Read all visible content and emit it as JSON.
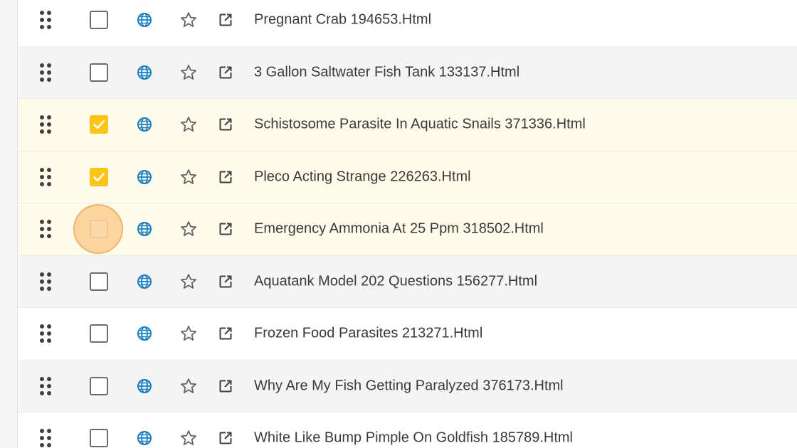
{
  "colors": {
    "checked": "#fcc419",
    "selected_row_bg": "#fffbea",
    "alt_row_bg": "#f4f4f4",
    "globe": "#1a7fc1",
    "focus_ring": "#fbd4a0"
  },
  "icons": {
    "drag": "drag-handle-icon",
    "checkbox": "checkbox",
    "globe": "globe-icon",
    "star": "star-icon",
    "open": "open-external-icon"
  },
  "rows": [
    {
      "title": "Pregnant Crab 194653.Html",
      "checked": false,
      "focus": false,
      "alt": false,
      "selected": false
    },
    {
      "title": "3 Gallon Saltwater Fish Tank 133137.Html",
      "checked": false,
      "focus": false,
      "alt": true,
      "selected": false
    },
    {
      "title": "Schistosome Parasite In Aquatic Snails 371336.Html",
      "checked": true,
      "focus": false,
      "alt": false,
      "selected": true
    },
    {
      "title": "Pleco Acting Strange 226263.Html",
      "checked": true,
      "focus": false,
      "alt": false,
      "selected": true
    },
    {
      "title": "Emergency Ammonia At 25 Ppm 318502.Html",
      "checked": false,
      "focus": true,
      "alt": false,
      "selected": true
    },
    {
      "title": "Aquatank Model 202 Questions 156277.Html",
      "checked": false,
      "focus": false,
      "alt": true,
      "selected": false
    },
    {
      "title": "Frozen Food Parasites 213271.Html",
      "checked": false,
      "focus": false,
      "alt": false,
      "selected": false
    },
    {
      "title": "Why Are My Fish Getting Paralyzed 376173.Html",
      "checked": false,
      "focus": false,
      "alt": true,
      "selected": false
    },
    {
      "title": "White Like Bump Pimple On Goldfish 185789.Html",
      "checked": false,
      "focus": false,
      "alt": false,
      "selected": false
    }
  ]
}
